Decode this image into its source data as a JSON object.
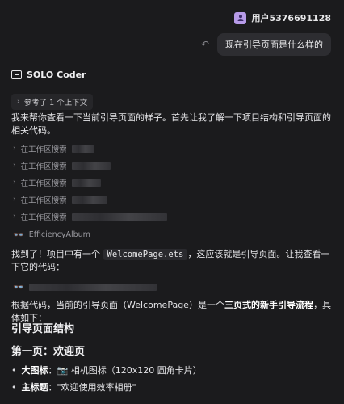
{
  "user": {
    "name": "用户5376691128"
  },
  "user_message": "现在引导页面是什么样的",
  "agent": {
    "name": "SOLO Coder"
  },
  "context_chip": "参考了 1 个上下文",
  "intro": "我来帮你查看一下当前引导页面的样子。首先让我了解一下项目结构和引导页面的相关代码。",
  "search_label": "在工作区搜索",
  "project_folder": "EfficiencyAlbum",
  "found": {
    "prefix": "找到了！项目中有一个",
    "file": "WelcomePage.ets",
    "suffix": "，这应该就是引导页面。让我查看一下它的代码："
  },
  "summary": {
    "prefix": "根据代码，当前的引导页面（WelcomePage）是一个",
    "bold": "三页式的新手引导流程",
    "suffix": "，具体如下："
  },
  "heading_structure": "引导页面结构",
  "heading_page1": "第一页：欢迎页",
  "bullets": [
    {
      "label": "大图标",
      "text": "：📷 相机图标（120x120 圆角卡片）"
    },
    {
      "label": "主标题",
      "text": "：\"欢迎使用效率相册\""
    }
  ]
}
